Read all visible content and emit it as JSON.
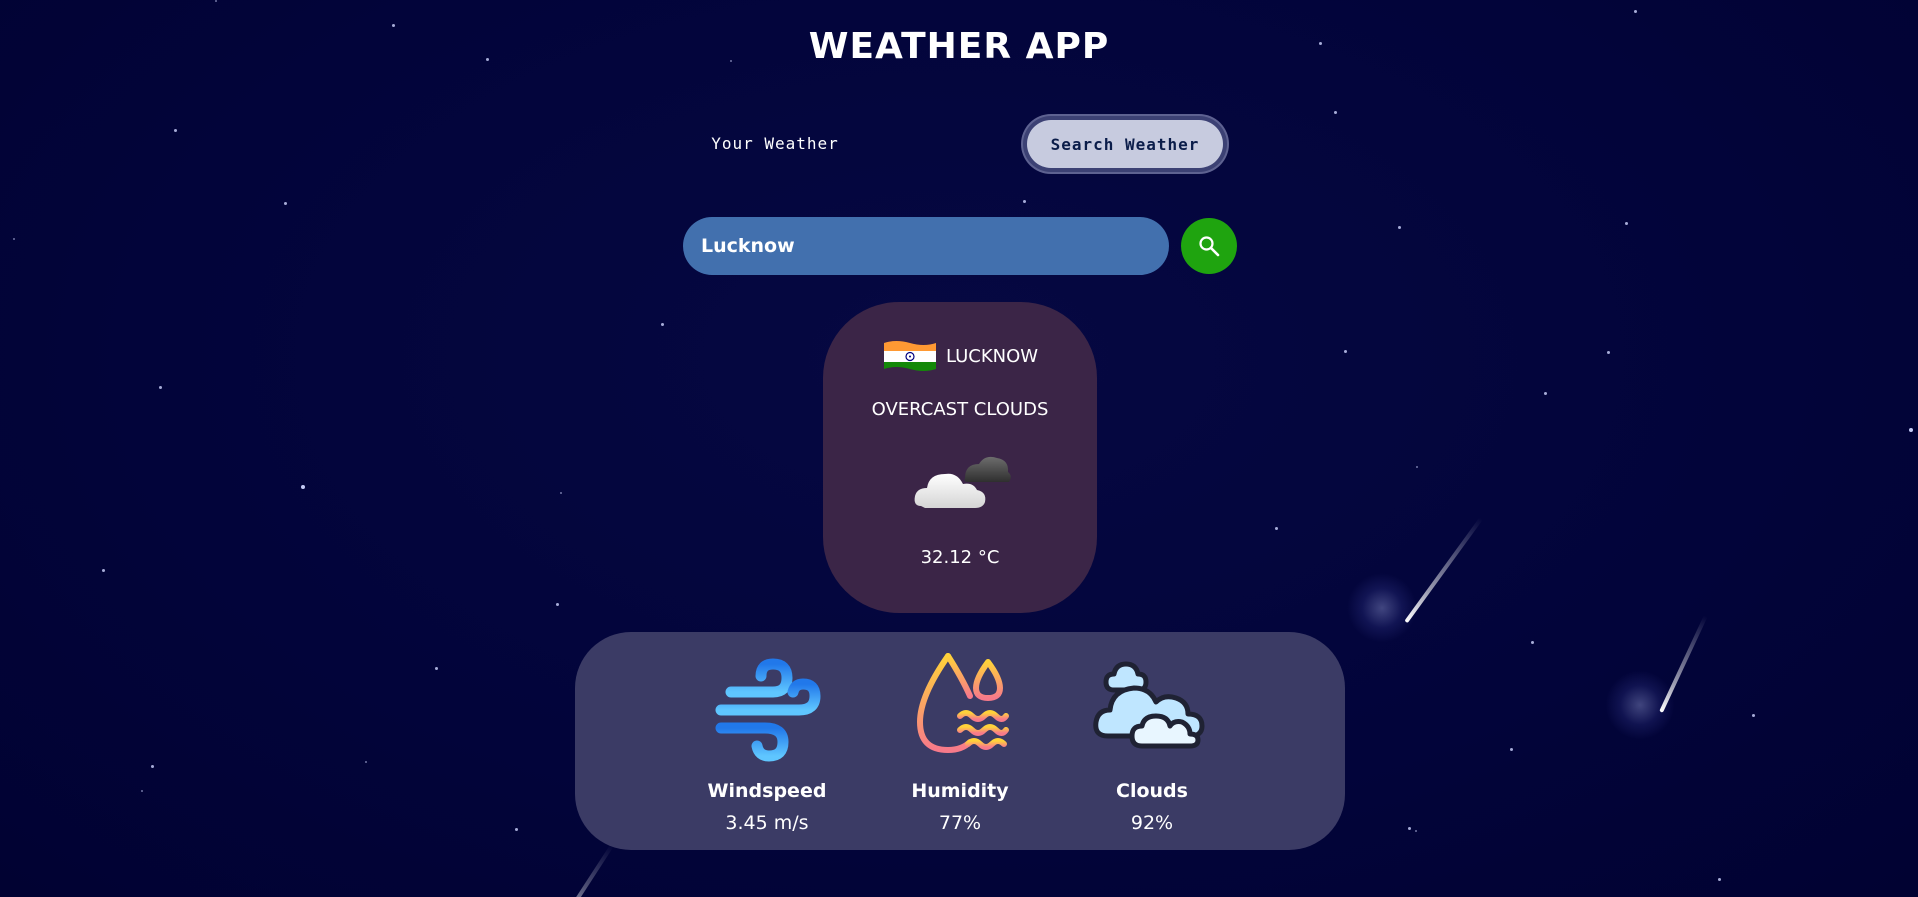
{
  "app": {
    "title": "WEATHER APP"
  },
  "tabs": {
    "your_weather": "Your Weather",
    "search_weather": "Search Weather",
    "active": "search_weather"
  },
  "search": {
    "value": "Lucknow",
    "button_icon": "search-icon"
  },
  "current": {
    "flag_icon": "india-flag-icon",
    "city": "LUCKNOW",
    "condition": "OVERCAST CLOUDS",
    "condition_icon": "overcast-clouds-icon",
    "temperature": "32.12 °C"
  },
  "stats": {
    "windspeed": {
      "icon": "wind-icon",
      "label": "Windspeed",
      "value": "3.45 m/s"
    },
    "humidity": {
      "icon": "humidity-icon",
      "label": "Humidity",
      "value": "77%"
    },
    "clouds": {
      "icon": "clouds-icon",
      "label": "Clouds",
      "value": "92%"
    }
  },
  "colors": {
    "background": "#02043a",
    "search_input": "#4270ae",
    "search_button": "#1fa40f",
    "city_card": "#3b2547",
    "stats_card": "#3b3b65",
    "active_tab": "#c7cbdf"
  }
}
